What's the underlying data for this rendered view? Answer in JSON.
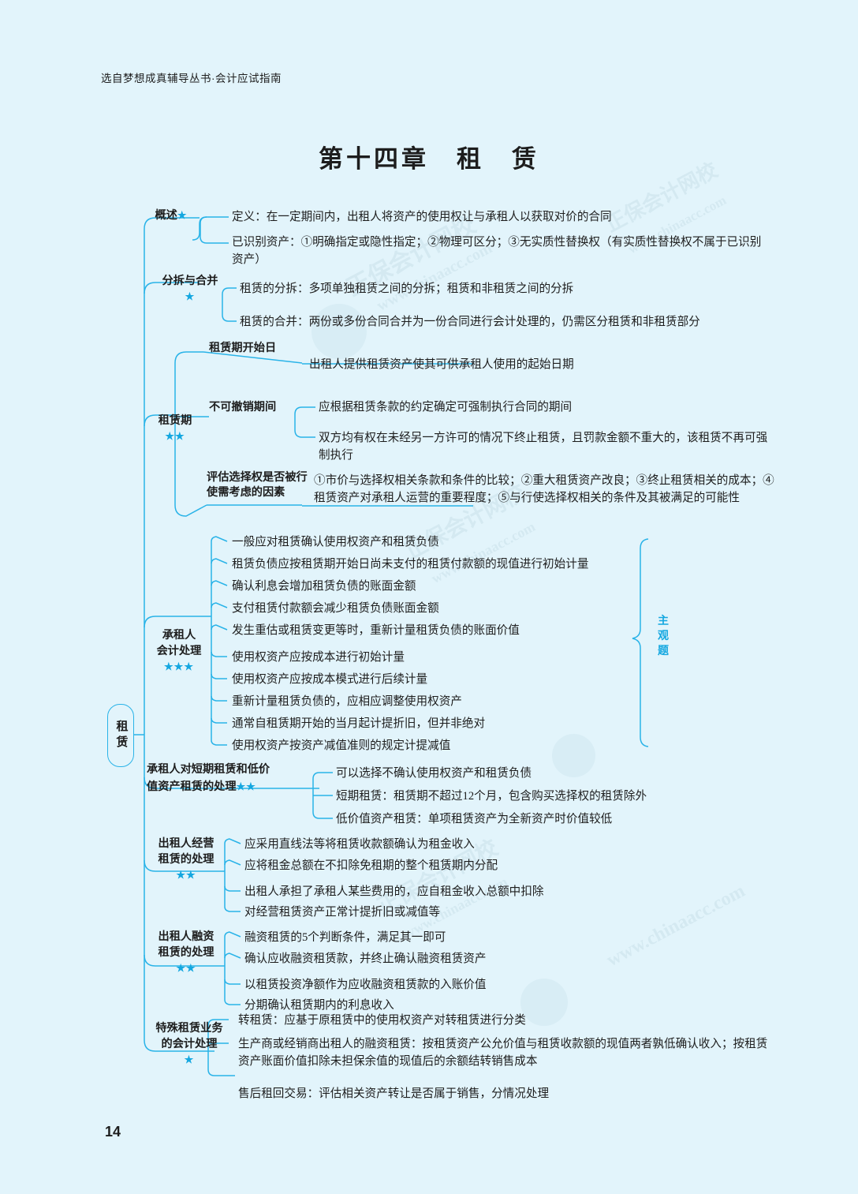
{
  "header": {
    "source_line": "选自梦想成真辅导丛书·会计应试指南",
    "chapter_title": "第十四章　租　赁",
    "page_number": "14"
  },
  "center": {
    "label": "租赁"
  },
  "side_marker": {
    "label": "主观题"
  },
  "branches": [
    {
      "id": "gaishu",
      "label": "概述",
      "stars": "★",
      "items": [
        {
          "text": "定义：在一定期间内，出租人将资产的使用权让与承租人以获取对价的合同"
        },
        {
          "text": "已识别资产：①明确指定或隐性指定；②物理可区分；③无实质性替换权（有实质性替换权不属于已识别资产）"
        }
      ]
    },
    {
      "id": "fenchai",
      "label": "分拆与合并",
      "stars": "★",
      "items": [
        {
          "text": "租赁的分拆：多项单独租赁之间的分拆；租赁和非租赁之间的分拆"
        },
        {
          "text": "租赁的合并：两份或多份合同合并为一份合同进行会计处理的，仍需区分租赁和非租赁部分"
        }
      ]
    },
    {
      "id": "zulinqi",
      "label": "租赁期",
      "stars": "★★",
      "sublabels": [
        {
          "label": "租赁期开始日",
          "items": [
            {
              "text": "出租人提供租赁资产使其可供承租人使用的起始日期"
            }
          ]
        },
        {
          "label": "不可撤销期间",
          "items": [
            {
              "text": "应根据租赁条款的约定确定可强制执行合同的期间"
            },
            {
              "text": "双方均有权在未经另一方许可的情况下终止租赁，且罚款金额不重大的，该租赁不再可强制执行"
            }
          ]
        },
        {
          "label": "评估选择权是否被行使需考虑的因素",
          "items": [
            {
              "text": "①市价与选择权相关条款和条件的比较；②重大租赁资产改良；③终止租赁相关的成本；④租赁资产对承租人运营的重要程度；⑤与行使选择权相关的条件及其被满足的可能性"
            }
          ]
        }
      ]
    },
    {
      "id": "chengzuren",
      "label": "承租人\n会计处理",
      "stars": "★★★",
      "items": [
        {
          "text": "一般应对租赁确认使用权资产和租赁负债"
        },
        {
          "text": "租赁负债应按租赁期开始日尚未支付的租赁付款额的现值进行初始计量"
        },
        {
          "text": "确认利息会增加租赁负债的账面金额"
        },
        {
          "text": "支付租赁付款额会减少租赁负债账面金额"
        },
        {
          "text": "发生重估或租赁变更等时，重新计量租赁负债的账面价值"
        },
        {
          "text": "使用权资产应按成本进行初始计量"
        },
        {
          "text": "使用权资产应按成本模式进行后续计量"
        },
        {
          "text": "重新计量租赁负债的，应相应调整使用权资产"
        },
        {
          "text": "通常自租赁期开始的当月起计提折旧，但并非绝对"
        },
        {
          "text": "使用权资产按资产减值准则的规定计提减值"
        }
      ]
    },
    {
      "id": "duanqi",
      "label": "承租人对短期租赁和低价\n值资产租赁的处理",
      "stars": "★★",
      "items": [
        {
          "text": "可以选择不确认使用权资产和租赁负债"
        },
        {
          "text": "短期租赁：租赁期不超过12个月，包含购买选择权的租赁除外"
        },
        {
          "text": "低价值资产租赁：单项租赁资产为全新资产时价值较低"
        }
      ]
    },
    {
      "id": "jingying",
      "label": "出租人经营\n租赁的处理",
      "stars": "★★",
      "items": [
        {
          "text": "应采用直线法等将租赁收款额确认为租金收入"
        },
        {
          "text": "应将租金总额在不扣除免租期的整个租赁期内分配"
        },
        {
          "text": "出租人承担了承租人某些费用的，应自租金收入总额中扣除"
        },
        {
          "text": "对经营租赁资产正常计提折旧或减值等"
        }
      ]
    },
    {
      "id": "rongzi",
      "label": "出租人融资\n租赁的处理",
      "stars": "★★",
      "items": [
        {
          "text": "融资租赁的5个判断条件，满足其一即可"
        },
        {
          "text": "确认应收融资租赁款，并终止确认融资租赁资产"
        },
        {
          "text": "以租赁投资净额作为应收融资租赁款的入账价值"
        },
        {
          "text": "分期确认租赁期内的利息收入"
        }
      ]
    },
    {
      "id": "teshu",
      "label": "特殊租赁业务\n的会计处理",
      "stars": "★",
      "items": [
        {
          "text": "转租赁：应基于原租赁中的使用权资产对转租赁进行分类"
        },
        {
          "text": "生产商或经销商出租人的融资租赁：按租赁资产公允价值与租赁收款额的现值两者孰低确认收入；按租赁资产账面价值扣除未担保余值的现值后的余额结转销售成本"
        },
        {
          "text": "售后租回交易：评估相关资产转让是否属于销售，分情况处理"
        }
      ]
    }
  ],
  "watermark": {
    "brand": "正保会计网校",
    "site": "www.chinaacc.com"
  },
  "colors": {
    "background": "#e2f4fb",
    "line": "#29b3e8",
    "accent": "#14a7e0",
    "text": "#1d1d1d"
  }
}
